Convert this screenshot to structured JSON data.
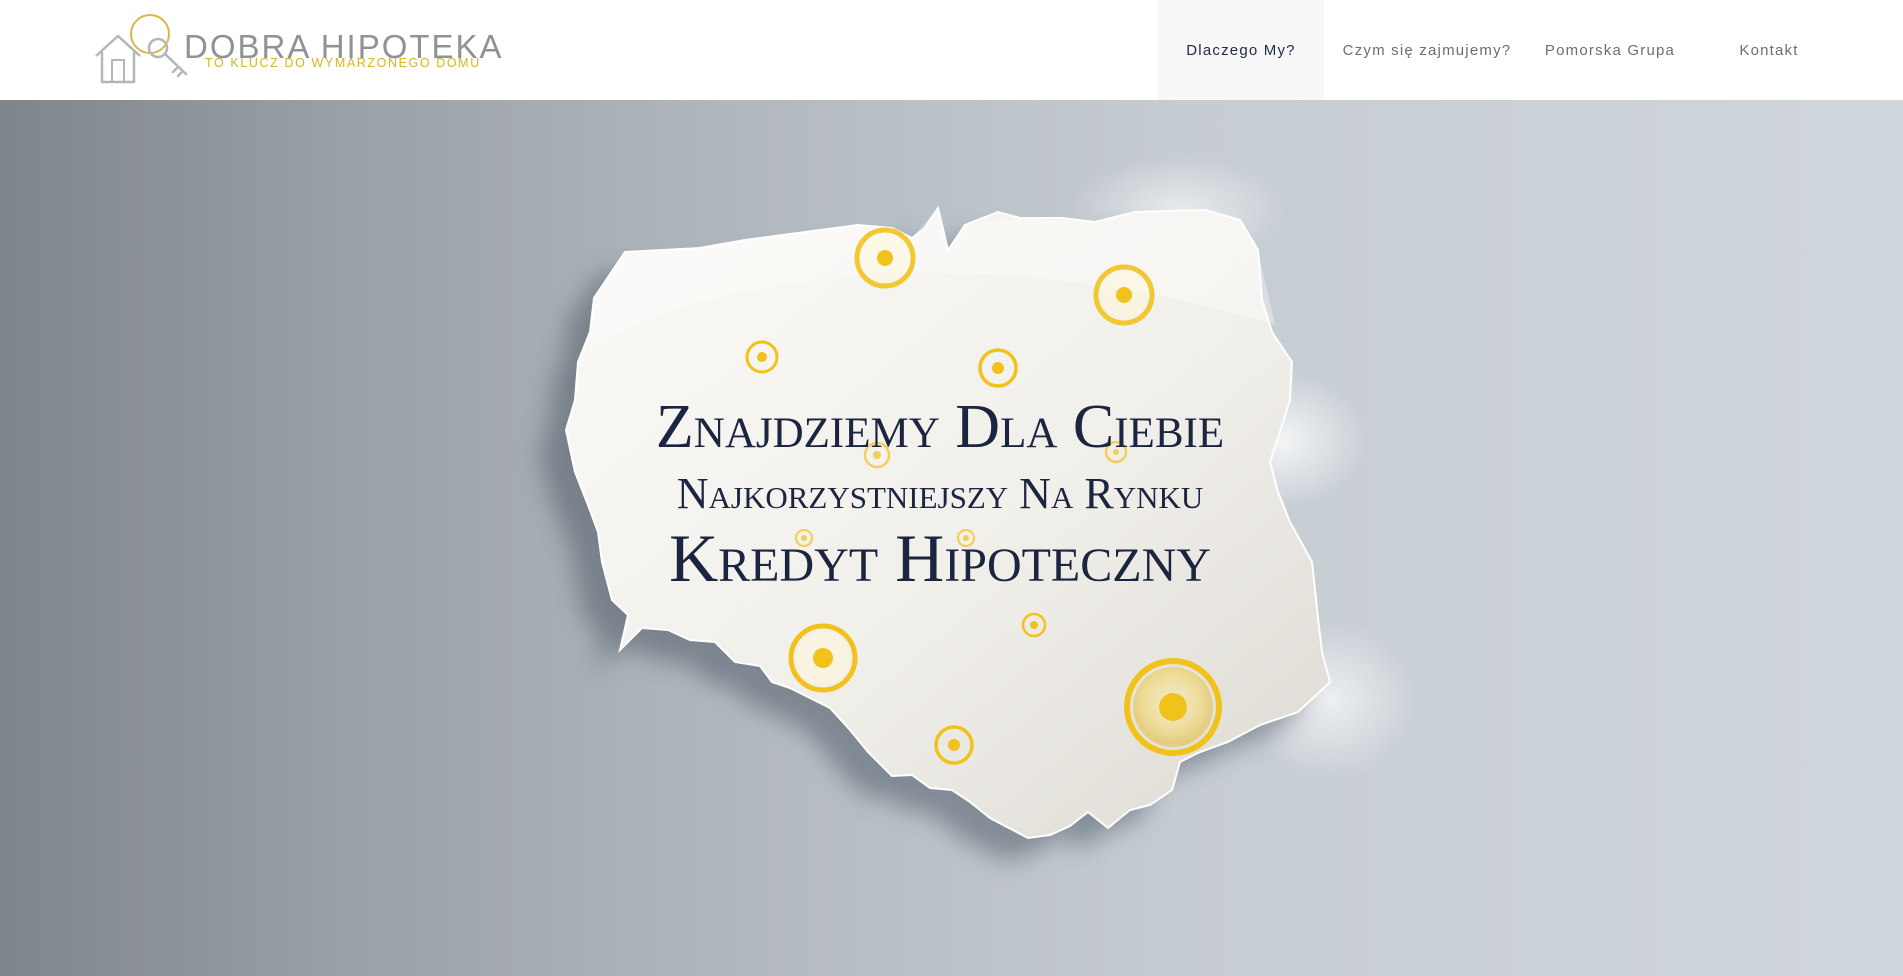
{
  "logo": {
    "title": "DOBRA HIPOTEKA",
    "tagline": "TO KLUCZ DO WYMARZONEGO DOMU",
    "icon": "house-key-icon"
  },
  "nav": {
    "items": [
      {
        "label": "Dlaczego My?",
        "active": true
      },
      {
        "label": "Czym się zajmujemy?",
        "active": false
      },
      {
        "label": "Pomorska Grupa",
        "active": false
      },
      {
        "label": "Kontakt",
        "active": false
      }
    ]
  },
  "hero": {
    "line1": "Znajdziemy Dla Ciebie",
    "line2": "Najkorzystniejszy Na Rynku",
    "line3": "Kredyt Hipoteczny",
    "map_icon": "poland-map-icon",
    "marker_icon": "location-dot-icon"
  },
  "colors": {
    "accent_gold": "#f2c21c",
    "heading_navy": "#1b2540",
    "nav_active_bg": "#f7f7f7"
  }
}
